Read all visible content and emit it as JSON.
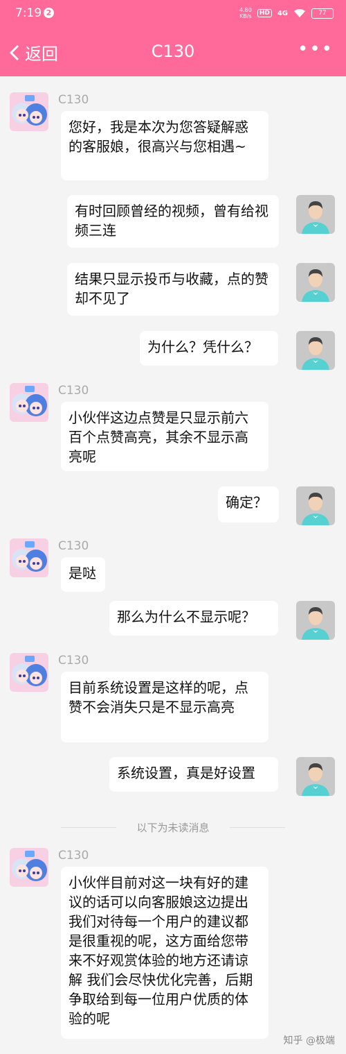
{
  "status": {
    "time": "7:19",
    "notif": "2",
    "speed_top": "4.80",
    "speed_unit": "KB/s",
    "hd": "HD",
    "net": "4G",
    "battery": "77"
  },
  "nav": {
    "back_label": "返回",
    "title": "C130",
    "more": "•••"
  },
  "messages": [
    {
      "side": "left",
      "name": "C130",
      "text": "您好，我是本次为您答疑解惑的客服娘，很高兴与您相遇~"
    },
    {
      "side": "right",
      "text": "有时回顾曾经的视频，曾有给视频三连"
    },
    {
      "side": "right",
      "text": "结果只显示投币与收藏，点的赞却不见了"
    },
    {
      "side": "right",
      "text": "为什么？凭什么？"
    },
    {
      "side": "left",
      "name": "C130",
      "text": "小伙伴这边点赞是只显示前六百个点赞高亮，其余不显示高亮呢"
    },
    {
      "side": "right",
      "text": "确定？"
    },
    {
      "side": "left",
      "name": "C130",
      "text": "是哒"
    },
    {
      "side": "right",
      "text": "那么为什么不显示呢？"
    },
    {
      "side": "left",
      "name": "C130",
      "text": "目前系统设置是这样的呢，点赞不会消失只是不显示高亮"
    },
    {
      "side": "right",
      "text": "系统设置，真是好设置"
    },
    {
      "side": "left",
      "name": "C130",
      "text": "小伙伴目前对这一块有好的建议的话可以向客服娘这边提出 我们对待每一个用户的建议都是很重视的呢，这方面给您带来不好观赏体验的地方还请谅解 我们会尽快优化完善，后期争取给到每一位用户优质的体验的呢"
    }
  ],
  "divider": "以下为未读消息",
  "watermark": "知乎 @极端"
}
